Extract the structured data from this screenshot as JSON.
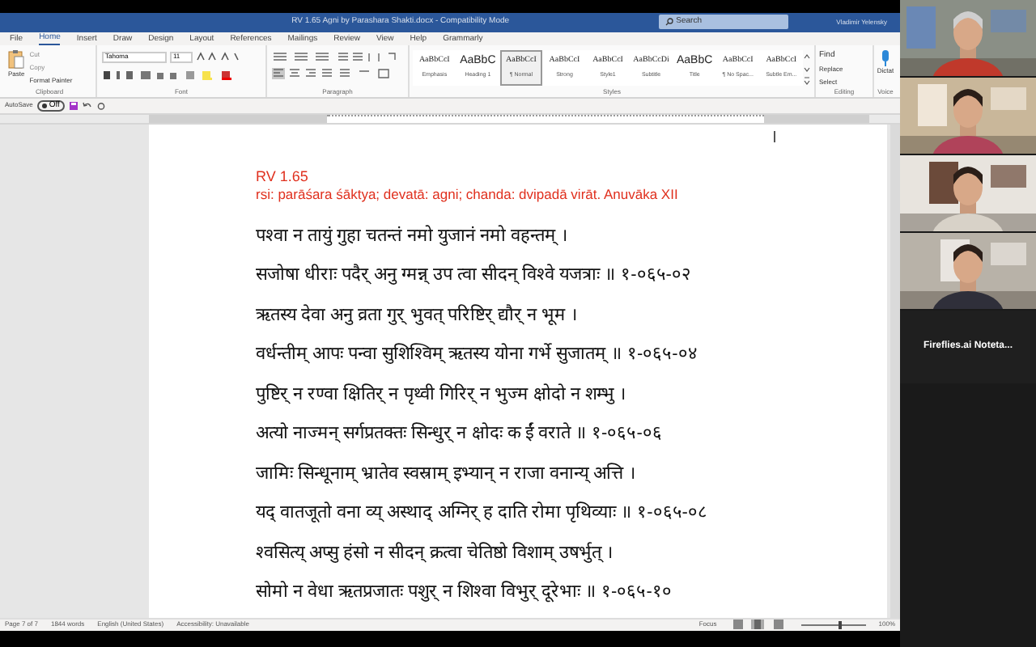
{
  "title_bar": {
    "title": "RV 1.65 Agni by Parashara Shakti.docx - Compatibility Mode",
    "search": "Search",
    "user": "Vladimir Yelensky"
  },
  "ribbon": {
    "tabs": [
      {
        "label": "File",
        "selected": false
      },
      {
        "label": "Home",
        "selected": true
      },
      {
        "label": "Insert",
        "selected": false
      },
      {
        "label": "Draw",
        "selected": false
      },
      {
        "label": "Design",
        "selected": false
      },
      {
        "label": "Layout",
        "selected": false
      },
      {
        "label": "References",
        "selected": false
      },
      {
        "label": "Mailings",
        "selected": false
      },
      {
        "label": "Review",
        "selected": false
      },
      {
        "label": "View",
        "selected": false
      },
      {
        "label": "Help",
        "selected": false
      },
      {
        "label": "Grammarly",
        "selected": false
      }
    ],
    "clipboard": {
      "paste": "Paste",
      "cut": "Cut",
      "copy": "Copy",
      "format_painter": "Format Painter",
      "label": "Clipboard"
    },
    "font": {
      "name": "Tahoma",
      "size": "11",
      "label": "Font"
    },
    "paragraph": {
      "label": "Paragraph"
    },
    "styles": {
      "label": "Styles",
      "items": [
        {
          "preview": "AaBbCcI",
          "name": "Emphasis",
          "selected": false
        },
        {
          "preview": "AaBbC",
          "name": "Heading 1",
          "selected": false
        },
        {
          "preview": "AaBbCcI",
          "name": "¶ Normal",
          "selected": true
        },
        {
          "preview": "AaBbCcI",
          "name": "Strong",
          "selected": false
        },
        {
          "preview": "AaBbCcI",
          "name": "Style1",
          "selected": false
        },
        {
          "preview": "AaBbCcDi",
          "name": "Subtitle",
          "selected": false
        },
        {
          "preview": "AaBbC",
          "name": "Title",
          "selected": false
        },
        {
          "preview": "AaBbCcI",
          "name": "¶ No Spac...",
          "selected": false
        },
        {
          "preview": "AaBbCcI",
          "name": "Subtle Em...",
          "selected": false
        }
      ]
    },
    "editing": {
      "find": "Find",
      "replace": "Replace",
      "select": "Select",
      "label": "Editing"
    },
    "voice": {
      "dictate": "Dictat",
      "label": "Voice"
    }
  },
  "quick_access": {
    "autosave": "AutoSave",
    "autosave_state": "Off"
  },
  "document": {
    "heading": "RV 1.65",
    "subheading": "rsi: parāśara śāktya; devatā: agni; chanda: dvipadā virāt. Anuvāka XII",
    "verses": [
      "पश्वा न तायुं गुहा चतन्तं नमो युजानं नमो वहन्तम् ।",
      "सजोषा धीराः पदैर् अनु ग्मन्न् उप त्वा सीदन् विश्वे यजत्राः ॥ १-०६५-०२",
      "ऋतस्य देवा अनु व्रता गुर् भुवत् परिष्टिर् द्यौर् न भूम ।",
      "वर्धन्तीम् आपः पन्वा सुशिश्विम् ऋतस्य योना गर्भे सुजातम् ॥ १-०६५-०४",
      "पुष्टिर् न रण्वा क्षितिर् न पृथ्वी गिरिर् न भुज्म क्षोदो न शम्भु ।",
      "अत्यो नाज्मन् सर्गप्रतक्तः सिन्धुर् न क्षोदः क ईं वराते ॥ १-०६५-०६",
      "जामिः सिन्धूनाम् भ्रातेव स्वस्राम् इभ्यान् न राजा वनान्य् अत्ति ।",
      "यद् वातजूतो वना व्य् अस्थाद् अग्निर् ह दाति रोमा पृथिव्याः ॥ १-०६५-०८",
      "श्वसित्य् अप्सु हंसो न सीदन् क्रत्वा चेतिष्ठो विशाम् उषर्भुत् ।",
      "सोमो न वेधा ऋतप्रजातः पशुर् न शिश्वा विभुर् दूरेभाः ॥ १-०६५-१०"
    ]
  },
  "status_bar": {
    "page": "Page 7 of 7",
    "words": "1844 words",
    "language": "English (United States)",
    "accessibility": "Accessibility: Unavailable",
    "focus": "Focus",
    "zoom_slider": {
      "level": 0.6
    },
    "zoom": "100%"
  },
  "participants": [
    {
      "kind": "picture"
    },
    {
      "kind": "picture"
    },
    {
      "kind": "picture"
    },
    {
      "kind": "picture"
    },
    {
      "kind": "name",
      "name": "Fireflies.ai Noteta..."
    }
  ]
}
